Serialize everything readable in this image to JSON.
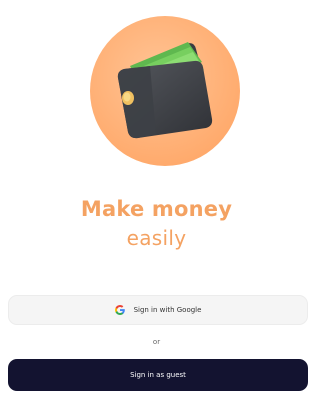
{
  "hero": {
    "icon": "wallet-illustration",
    "circle_color": "#ffb27f"
  },
  "headline": {
    "line1": "Make money",
    "line2": "easily",
    "color": "#f4a262"
  },
  "auth": {
    "google_label": "Sign in with Google",
    "google_icon": "google-g-icon",
    "separator": "or",
    "guest_label": "Sign in as guest",
    "guest_bg": "#131330"
  }
}
